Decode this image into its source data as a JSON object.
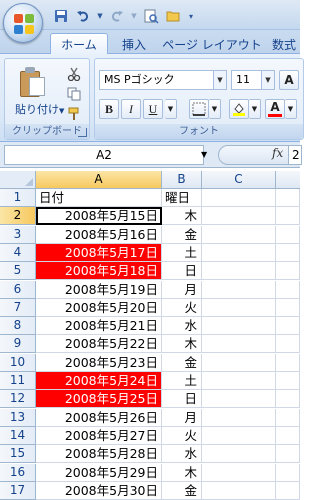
{
  "quick_access": {
    "icons": [
      "save-icon",
      "undo-icon",
      "redo-icon",
      "print-preview-icon",
      "open-icon",
      "customize-icon"
    ]
  },
  "ribbon_tabs": [
    "ホーム",
    "挿入",
    "ページ レイアウト",
    "数式"
  ],
  "clipboard": {
    "paste_label": "貼り付け",
    "group_label": "クリップボード"
  },
  "font": {
    "name": "MS Pゴシック",
    "size": "11",
    "group_label": "フォント",
    "bold": "B",
    "italic": "I",
    "underline": "U",
    "font_color_letter": "A",
    "highlight_color": "#ffff00",
    "font_color": "#ff0000"
  },
  "formula_bar": {
    "name_box": "A2",
    "fx": "fx",
    "value": "2"
  },
  "columns": [
    "A",
    "B",
    "C"
  ],
  "rows": [
    {
      "num": "1",
      "a": "日付",
      "b": "曜日",
      "highlight": false,
      "header": true
    },
    {
      "num": "2",
      "a": "2008年5月15日",
      "b": "木",
      "highlight": false
    },
    {
      "num": "3",
      "a": "2008年5月16日",
      "b": "金",
      "highlight": false
    },
    {
      "num": "4",
      "a": "2008年5月17日",
      "b": "土",
      "highlight": true
    },
    {
      "num": "5",
      "a": "2008年5月18日",
      "b": "日",
      "highlight": true
    },
    {
      "num": "6",
      "a": "2008年5月19日",
      "b": "月",
      "highlight": false
    },
    {
      "num": "7",
      "a": "2008年5月20日",
      "b": "火",
      "highlight": false
    },
    {
      "num": "8",
      "a": "2008年5月21日",
      "b": "水",
      "highlight": false
    },
    {
      "num": "9",
      "a": "2008年5月22日",
      "b": "木",
      "highlight": false
    },
    {
      "num": "10",
      "a": "2008年5月23日",
      "b": "金",
      "highlight": false
    },
    {
      "num": "11",
      "a": "2008年5月24日",
      "b": "土",
      "highlight": true
    },
    {
      "num": "12",
      "a": "2008年5月25日",
      "b": "日",
      "highlight": true
    },
    {
      "num": "13",
      "a": "2008年5月26日",
      "b": "月",
      "highlight": false
    },
    {
      "num": "14",
      "a": "2008年5月27日",
      "b": "火",
      "highlight": false
    },
    {
      "num": "15",
      "a": "2008年5月28日",
      "b": "水",
      "highlight": false
    },
    {
      "num": "16",
      "a": "2008年5月29日",
      "b": "木",
      "highlight": false
    },
    {
      "num": "17",
      "a": "2008年5月30日",
      "b": "金",
      "highlight": false
    }
  ],
  "colors": {
    "highlight_fill": "#ff0000",
    "highlight_text": "#ffffff",
    "selection_header": "#f7c85f",
    "ribbon_text": "#15428b"
  }
}
